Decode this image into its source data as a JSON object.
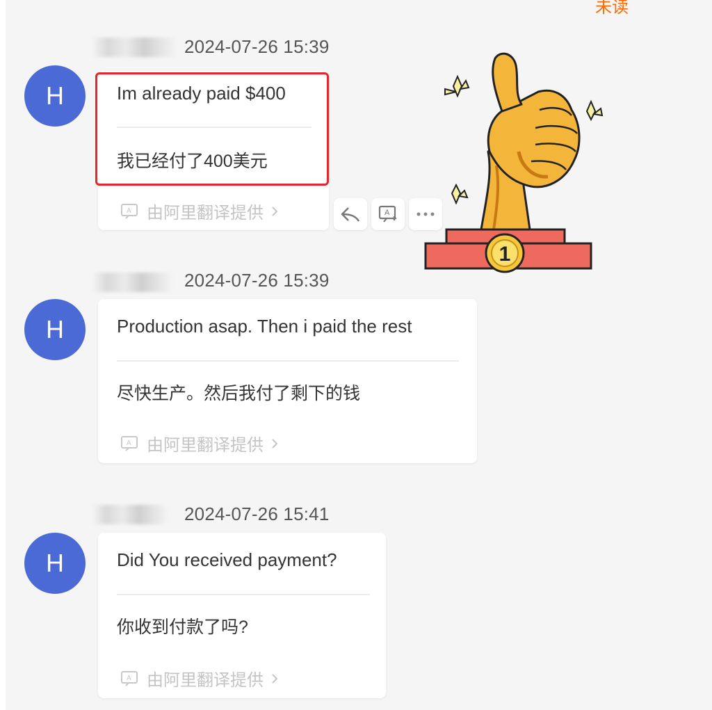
{
  "header": {
    "unread_label": "未读"
  },
  "messages": [
    {
      "avatar_letter": "H",
      "timestamp": "2024-07-26 15:39",
      "original": "Im already paid $400",
      "translation": "我已经付了400美元",
      "provider": "由阿里翻译提供"
    },
    {
      "avatar_letter": "H",
      "timestamp": "2024-07-26 15:39",
      "original": "Production asap. Then i paid the rest",
      "translation": "尽快生产。然后我付了剩下的钱",
      "provider": "由阿里翻译提供"
    },
    {
      "avatar_letter": "H",
      "timestamp": "2024-07-26 15:41",
      "original": "Did You received payment?",
      "translation": "你收到付款了吗?",
      "provider": "由阿里翻译提供"
    }
  ],
  "actions": [
    {
      "icon": "reply-icon"
    },
    {
      "icon": "translate-icon"
    },
    {
      "icon": "more-icon"
    }
  ],
  "sticker": {
    "icon": "thumbs-up-trophy",
    "medal_text": "1"
  },
  "colors": {
    "avatar": "#4b6ad6",
    "highlight": "#e5252b",
    "unread": "#ff6a00",
    "background": "#f5f5f5"
  }
}
